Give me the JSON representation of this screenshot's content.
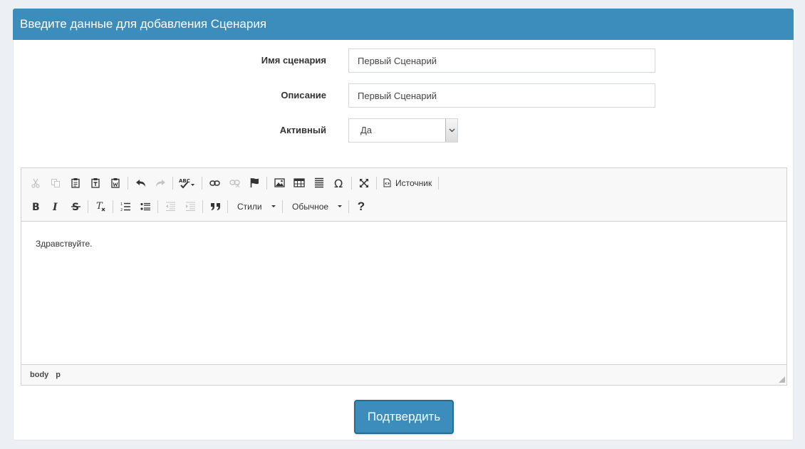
{
  "header": {
    "title": "Введите данные для добавления Сценария"
  },
  "form": {
    "name": {
      "label": "Имя сценария",
      "value": "Первый Сценарий"
    },
    "description": {
      "label": "Описание",
      "value": "Первый Сценарий"
    },
    "active": {
      "label": "Активный",
      "selected": "Да"
    }
  },
  "editor": {
    "toolbar": {
      "source_label": "Источник",
      "styles_label": "Стили",
      "format_label": "Обычное",
      "help_label": "?"
    },
    "content": "Здравствуйте.",
    "path": [
      "body",
      "p"
    ]
  },
  "submit": {
    "label": "Подтвердить"
  },
  "colors": {
    "accent": "#3c8dbc",
    "background": "#ecf0f5"
  }
}
